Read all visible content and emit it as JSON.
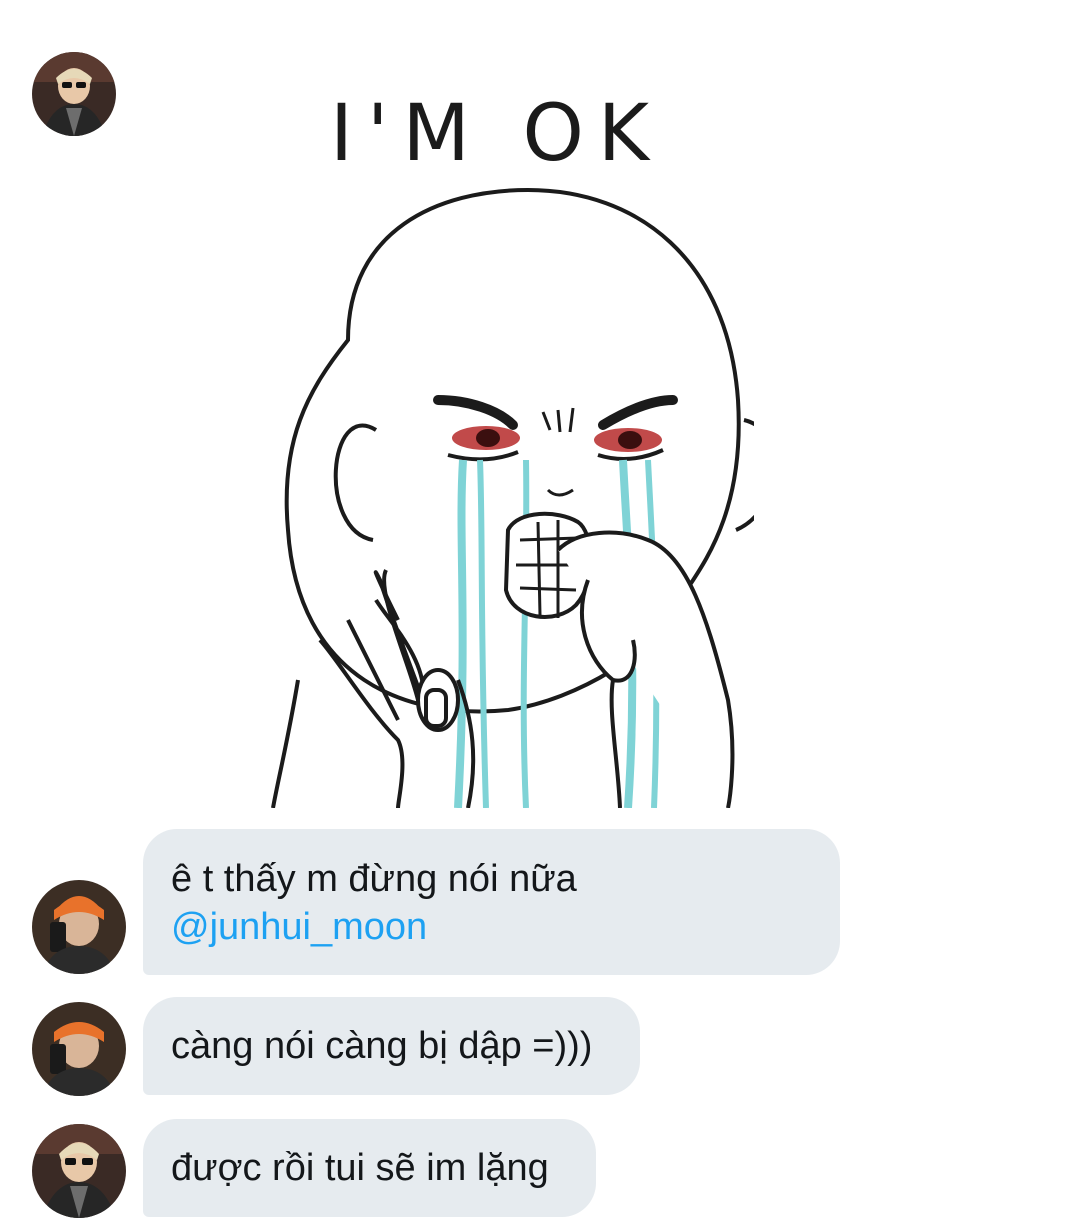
{
  "conversation": {
    "sticker": {
      "caption": "I'M OK"
    },
    "messages": [
      {
        "sender": "orange-beanie-user",
        "text": "ê t thấy m đừng nói nữa",
        "mention": "@junhui_moon"
      },
      {
        "sender": "orange-beanie-user",
        "text": "càng nói càng bị dập =)))"
      },
      {
        "sender": "sunglasses-user",
        "text": "được rồi tui sẽ im lặng"
      }
    ]
  },
  "colors": {
    "bubble_background": "#e6ebef",
    "bubble_text": "#14171a",
    "mention": "#1da1f2",
    "tear": "#7fd3d6",
    "eye_red": "#b33b3b"
  }
}
